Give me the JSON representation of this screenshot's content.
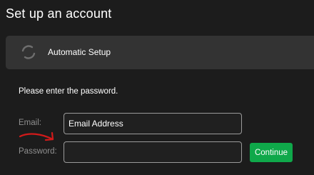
{
  "page": {
    "title": "Set up an account"
  },
  "setup_bar": {
    "label": "Automatic Setup",
    "icon": "refresh-spinner-icon"
  },
  "form": {
    "prompt": "Please enter the password.",
    "email_label": "Email:",
    "email_value": "Email Address",
    "password_label": "Password:",
    "password_value": "",
    "continue_label": "Continue"
  },
  "annotation": {
    "icon": "hand-drawn-arrow-icon",
    "color": "#d11a1a"
  },
  "colors": {
    "background": "#1c1c1c",
    "bar": "#333333",
    "accent": "#0fa84a"
  }
}
